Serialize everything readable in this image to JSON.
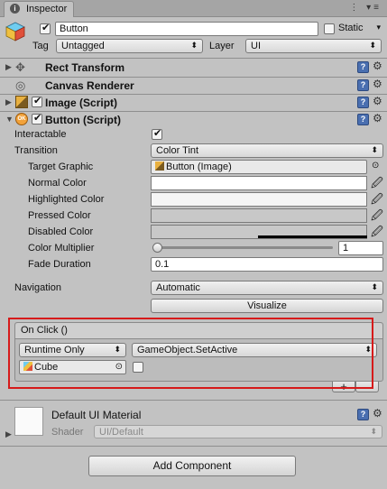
{
  "window": {
    "tab_label": "Inspector",
    "tab_icons": "⋮ ▾≡"
  },
  "header": {
    "active": true,
    "name_value": "Button",
    "static_label": "Static",
    "static_checked": false,
    "tag_label": "Tag",
    "tag_value": "Untagged",
    "layer_label": "Layer",
    "layer_value": "UI"
  },
  "components": {
    "rect_transform": {
      "title": "Rect Transform"
    },
    "canvas_renderer": {
      "title": "Canvas Renderer"
    },
    "image": {
      "title": "Image (Script)",
      "enabled": true
    },
    "button": {
      "title": "Button (Script)",
      "enabled": true,
      "interactable_label": "Interactable",
      "interactable_checked": true,
      "transition_label": "Transition",
      "transition_value": "Color Tint",
      "target_graphic_label": "Target Graphic",
      "target_graphic_value": "Button (Image)",
      "normal_color_label": "Normal Color",
      "normal_color": "#ffffff",
      "highlighted_color_label": "Highlighted Color",
      "highlighted_color": "#f5f5f5",
      "pressed_color_label": "Pressed Color",
      "pressed_color": "#c8c8c8",
      "disabled_color_label": "Disabled Color",
      "disabled_color": "#c8c8c8",
      "color_multiplier_label": "Color Multiplier",
      "color_multiplier_value": "1",
      "color_multiplier_fraction": 0.0,
      "fade_duration_label": "Fade Duration",
      "fade_duration_value": "0.1",
      "navigation_label": "Navigation",
      "navigation_value": "Automatic",
      "visualize_label": "Visualize",
      "on_click": {
        "title": "On Click ()",
        "runtime_value": "Runtime Only",
        "function_value": "GameObject.SetActive",
        "object_value": "Cube",
        "arg_checked": false,
        "plus_label": "+"
      }
    }
  },
  "material": {
    "title": "Default UI Material",
    "shader_label": "Shader",
    "shader_value": "UI/Default"
  },
  "footer": {
    "add_component_label": "Add Component"
  },
  "colors": {
    "highlight_outline": "#d61a1a",
    "help_icon": "#4a6fb0"
  }
}
